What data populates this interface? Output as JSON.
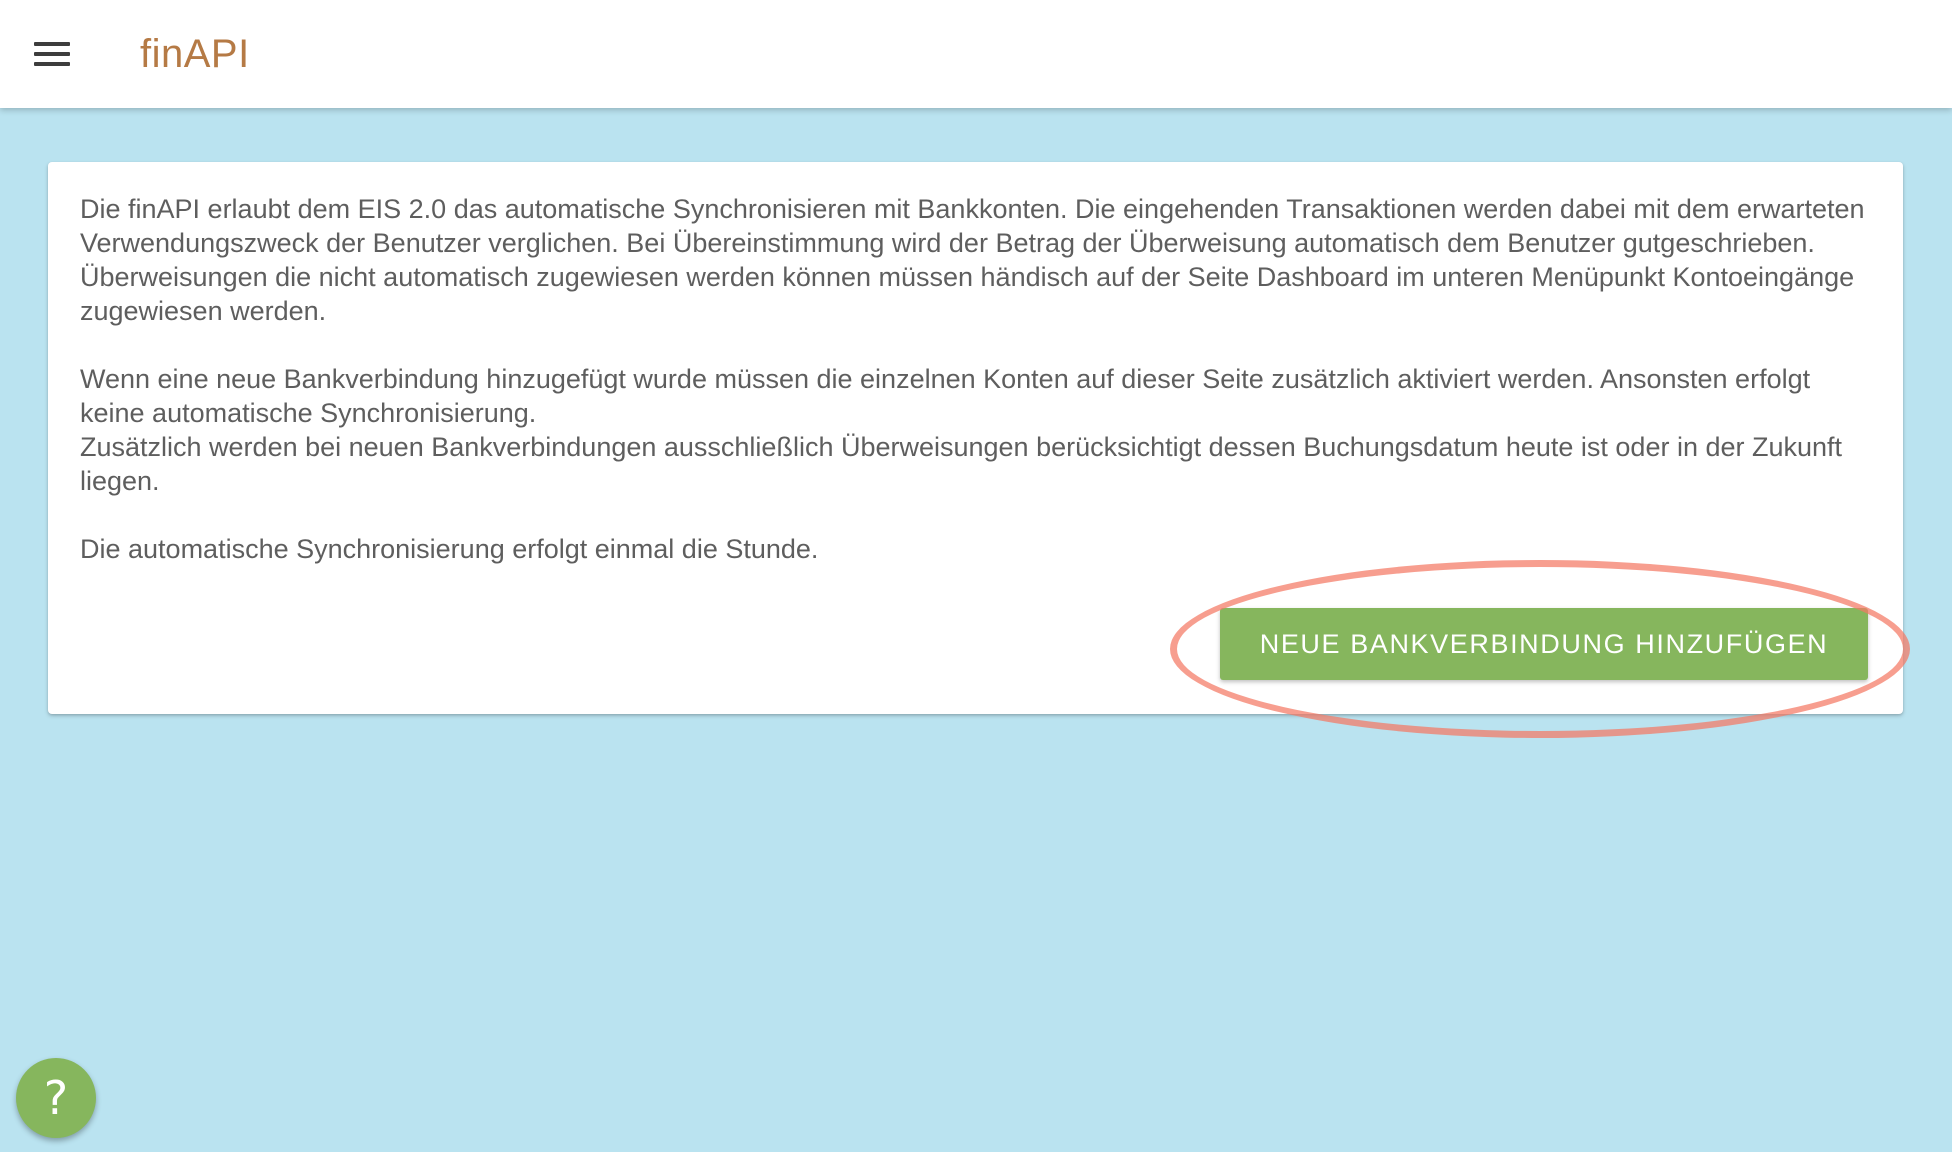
{
  "header": {
    "brand": "finAPI",
    "menu_icon": "hamburger-menu-icon"
  },
  "info_card": {
    "paragraph1": "Die finAPI erlaubt dem EIS 2.0 das automatische Synchronisieren mit Bankkonten. Die eingehenden Transaktionen werden dabei mit dem erwarteten Verwendungszweck der Benutzer verglichen. Bei Übereinstimmung wird der Betrag der Überweisung automatisch dem Benutzer gutgeschrieben. Überweisungen die nicht automatisch zugewiesen werden können müssen händisch auf der Seite Dashboard im unteren Menüpunkt Kontoeingänge zugewiesen werden.",
    "paragraph2_line1": "Wenn eine neue Bankverbindung hinzugefügt wurde müssen die einzelnen Konten auf dieser Seite zusätzlich aktiviert werden. Ansonsten erfolgt keine automatische Synchronisierung.",
    "paragraph2_line2": "Zusätzlich werden bei neuen Bankverbindungen ausschließlich Überweisungen berücksichtigt dessen Buchungsdatum heute ist oder in der Zukunft liegen.",
    "paragraph3": "Die automatische Synchronisierung erfolgt einmal die Stunde.",
    "add_button_label": "NEUE BANKVERBINDUNG HINZUFÜGEN"
  },
  "help_button": {
    "label": "?"
  },
  "colors": {
    "background": "#bae3f0",
    "brand": "#b57a45",
    "button_green": "#86b65d",
    "highlight_ring": "#f47864",
    "text": "#5e5e5e"
  }
}
